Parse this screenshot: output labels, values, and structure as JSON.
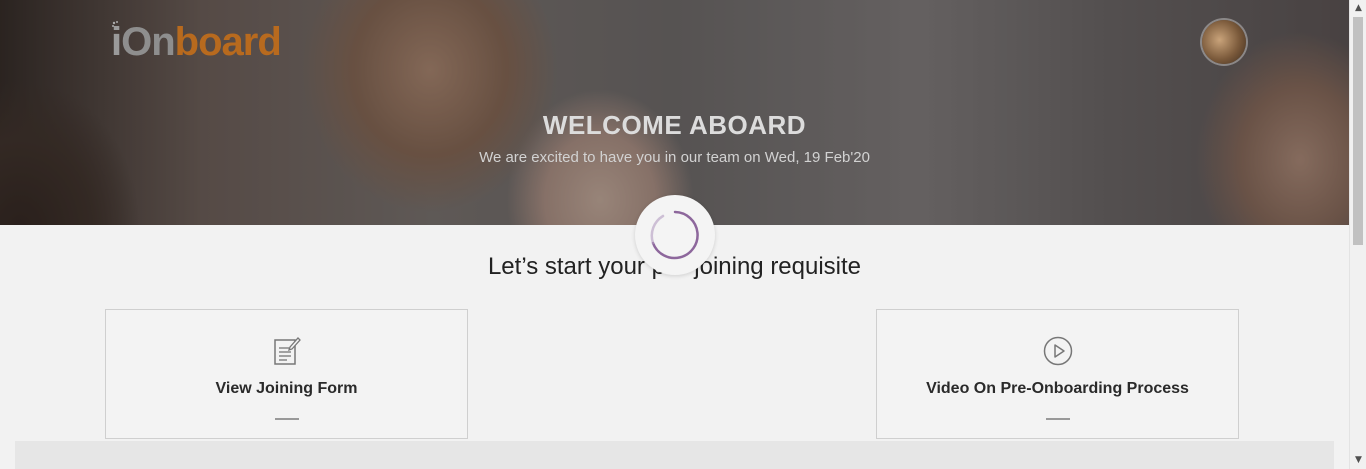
{
  "header": {
    "logo": {
      "part_i": "i",
      "part_on": "On",
      "part_board": "board"
    },
    "avatar_icon": "user-avatar"
  },
  "hero": {
    "title": "WELCOME ABOARD",
    "subtitle": "We are excited to have you in our team on Wed, 19 Feb'20"
  },
  "main": {
    "heading": "Let’s start your pre-joining requisite",
    "cards": [
      {
        "label": "View Joining Form",
        "icon": "form-edit-icon"
      },
      {
        "label": "Video On Pre-Onboarding Process",
        "icon": "play-circle-icon"
      }
    ]
  },
  "loader": {
    "icon": "loading-spinner-icon"
  },
  "colors": {
    "brand_orange": "#b86a1e",
    "spinner": "#7a4d8c",
    "logo_gray": "#8e8e8e"
  }
}
